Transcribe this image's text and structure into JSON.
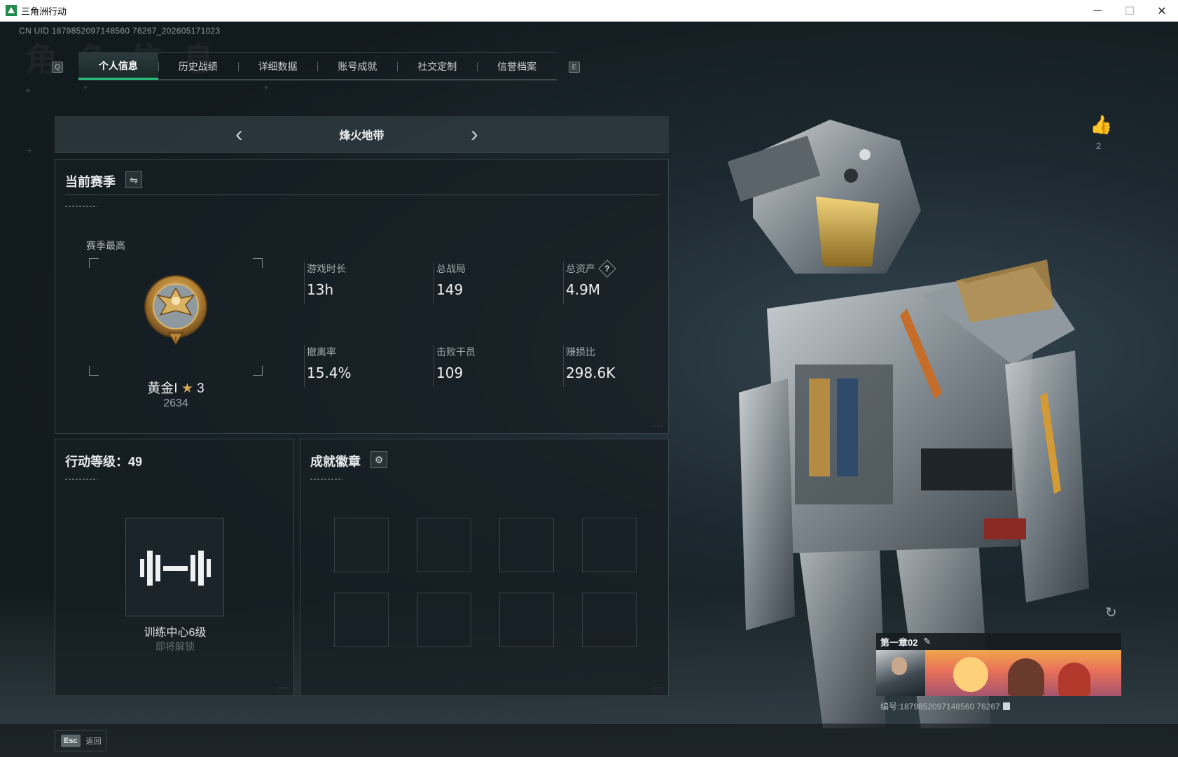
{
  "window": {
    "title": "三角洲行动",
    "minimize": "─",
    "maximize": "☐",
    "close": "✕"
  },
  "header": {
    "uid_text": "CN UID 1879852097148560 76267_202605171023"
  },
  "tabs": {
    "key_prev": "Q",
    "key_next": "E",
    "items": [
      {
        "label": "个人信息"
      },
      {
        "label": "历史战绩"
      },
      {
        "label": "详细数据"
      },
      {
        "label": "账号成就"
      },
      {
        "label": "社交定制"
      },
      {
        "label": "信誉档案"
      }
    ]
  },
  "mode": {
    "title": "烽火地带",
    "prev": "‹",
    "next": "›"
  },
  "season": {
    "title": "当前赛季",
    "swap_icon": "⇋",
    "best_label": "赛季最高",
    "rank_name": "黄金I",
    "rank_star": "★",
    "rank_stars_count": "3",
    "rank_score": "2634",
    "stats": [
      {
        "label": "游戏时长",
        "value": "13h"
      },
      {
        "label": "总战局",
        "value": "149"
      },
      {
        "label": "总资产",
        "value": "4.9M",
        "help": "?"
      },
      {
        "label": "撤离率",
        "value": "15.4%"
      },
      {
        "label": "击败干员",
        "value": "109"
      },
      {
        "label": "赚损比",
        "value": "298.6K"
      }
    ]
  },
  "level": {
    "title": "行动等级：49",
    "badge_caption": "训练中心6级",
    "badge_sub": "即将解锁"
  },
  "badges": {
    "title": "成就徽章",
    "settings_icon": "⚙"
  },
  "profile": {
    "like_icon": "👍",
    "like_count": "2",
    "rotate_icon": "↻",
    "card_title": "第一章02",
    "edit_icon": "✎",
    "card_id": "编号:1879852097148560 76267"
  },
  "bottom": {
    "esc_key": "Esc",
    "esc_label": "返回"
  }
}
